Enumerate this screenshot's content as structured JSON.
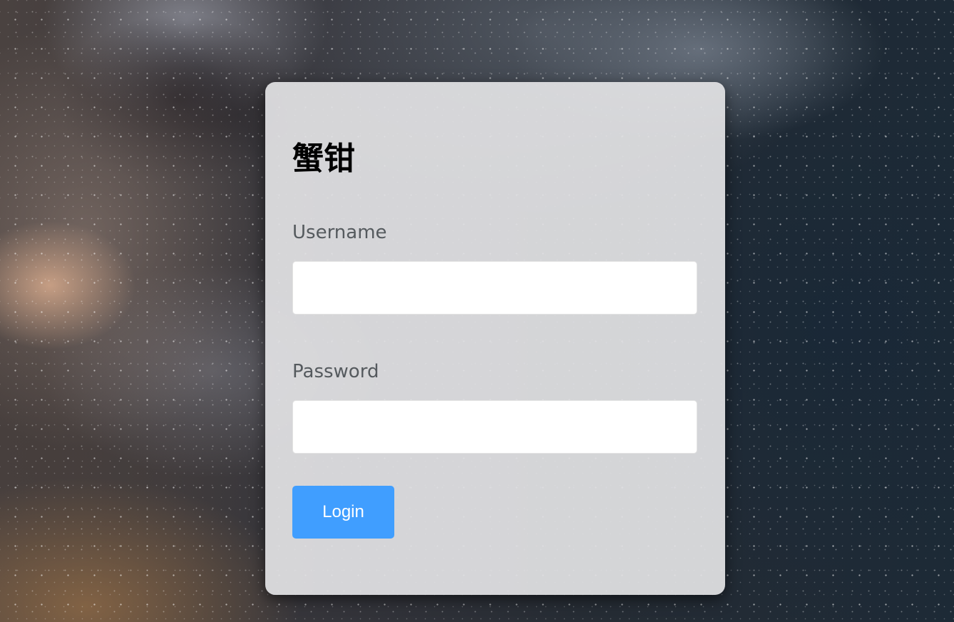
{
  "login": {
    "title": "蟹钳",
    "username_label": "Username",
    "username_value": "",
    "password_label": "Password",
    "password_value": "",
    "button_label": "Login"
  },
  "colors": {
    "button": "#409eff",
    "card": "#e2e2e4",
    "label": "#555a5e"
  }
}
